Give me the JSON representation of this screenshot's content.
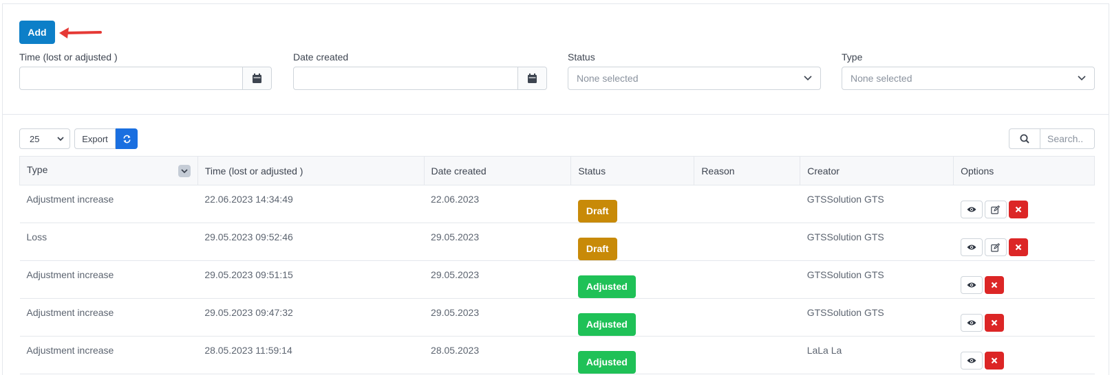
{
  "toolbar": {
    "add_label": "Add"
  },
  "filters": {
    "time_label": "Time (lost or adjusted )",
    "date_label": "Date created",
    "status_label": "Status",
    "status_placeholder": "None selected",
    "type_label": "Type",
    "type_placeholder": "None selected"
  },
  "controls": {
    "page_size": "25",
    "export_label": "Export",
    "search_placeholder": "Search.."
  },
  "table": {
    "headers": [
      "Type",
      "Time (lost or adjusted )",
      "Date created",
      "Status",
      "Reason",
      "Creator",
      "Options"
    ],
    "rows": [
      {
        "type": "Adjustment increase",
        "time": "22.06.2023 14:34:49",
        "date": "22.06.2023",
        "status": "Draft",
        "reason": "",
        "creator": "GTSSolution GTS"
      },
      {
        "type": "Loss",
        "time": "29.05.2023 09:52:46",
        "date": "29.05.2023",
        "status": "Draft",
        "reason": "",
        "creator": "GTSSolution GTS"
      },
      {
        "type": "Adjustment increase",
        "time": "29.05.2023 09:51:15",
        "date": "29.05.2023",
        "status": "Adjusted",
        "reason": "",
        "creator": "GTSSolution GTS"
      },
      {
        "type": "Adjustment increase",
        "time": "29.05.2023 09:47:32",
        "date": "29.05.2023",
        "status": "Adjusted",
        "reason": "",
        "creator": "GTSSolution GTS"
      },
      {
        "type": "Adjustment increase",
        "time": "28.05.2023 11:59:14",
        "date": "28.05.2023",
        "status": "Adjusted",
        "reason": "",
        "creator": "LaLa La"
      }
    ]
  },
  "colors": {
    "primary": "#0d7fc8",
    "draft": "#c88a08",
    "adjusted": "#1fc157",
    "danger": "#dc2626",
    "annotation_arrow": "#e53935"
  }
}
